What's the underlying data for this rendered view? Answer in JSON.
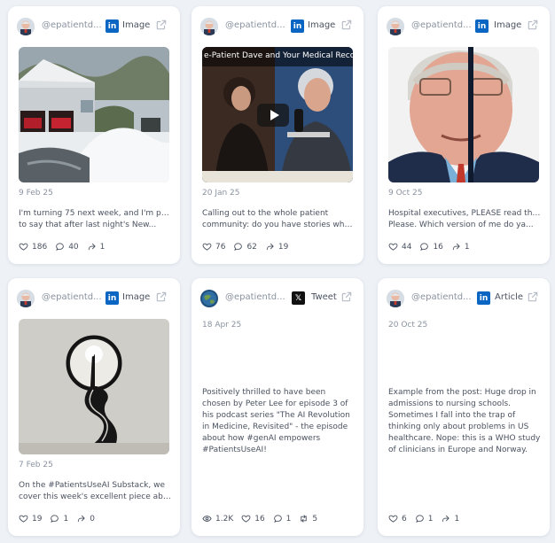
{
  "colors": {
    "linkedin": "#0a66c2",
    "x": "#111111",
    "background": "#eef2f7"
  },
  "cards": [
    {
      "handle": "@epatientd...",
      "source_icon": "linkedin-icon",
      "type_label": "Image",
      "media_title": "",
      "date": "9 Feb 25",
      "text_line1": "I'm turning 75 next week, and I'm proud",
      "text_line2": "to say that after last night's New...",
      "stats": {
        "likes": "186",
        "comments": "40",
        "shares": "1"
      }
    },
    {
      "handle": "@epatientd...",
      "source_icon": "linkedin-icon",
      "type_label": "Image",
      "media_title": "e-Patient Dave and Your Medical Recor...",
      "date": "20 Jan 25",
      "text_line1": "Calling out to the whole patient",
      "text_line2": "community: do you have stories wher...",
      "stats": {
        "likes": "76",
        "comments": "62",
        "shares": "19"
      }
    },
    {
      "handle": "@epatientd...",
      "source_icon": "linkedin-icon",
      "type_label": "Image",
      "media_title": "",
      "date": "9 Oct 25",
      "text_line1": "Hospital executives, PLEASE read this.",
      "text_line2": "Please. Which version of me do ya...",
      "stats": {
        "likes": "44",
        "comments": "16",
        "shares": "1"
      }
    },
    {
      "handle": "@epatientd...",
      "source_icon": "linkedin-icon",
      "type_label": "Image",
      "media_title": "",
      "date": "7 Feb 25",
      "text_line1": "On the #PatientsUseAI Substack, we",
      "text_line2": "cover this week's excellent piece abo...",
      "stats": {
        "likes": "19",
        "comments": "1",
        "shares": "0"
      }
    },
    {
      "handle": "@epatientd...",
      "source_icon": "x-icon",
      "type_label": "Tweet",
      "date": "18 Apr 25",
      "text_full": "Positively thrilled to have been chosen by Peter Lee for episode 3 of his podcast series \"The AI Revolution in Medicine, Revisited\" - the episode about how #genAI empowers #PatientsUseAI!",
      "stats": {
        "views": "1.2K",
        "likes": "16",
        "comments": "1",
        "retweets": "5"
      }
    },
    {
      "handle": "@epatientd...",
      "source_icon": "linkedin-icon",
      "type_label": "Article",
      "date": "20 Oct 25",
      "text_full": "Example from the post: Huge drop in admissions to nursing schools. Sometimes I fall into the trap of thinking only about problems in US healthcare. Nope: this is a WHO study of clinicians in Europe and Norway.",
      "stats": {
        "likes": "6",
        "comments": "1",
        "shares": "1"
      }
    }
  ]
}
